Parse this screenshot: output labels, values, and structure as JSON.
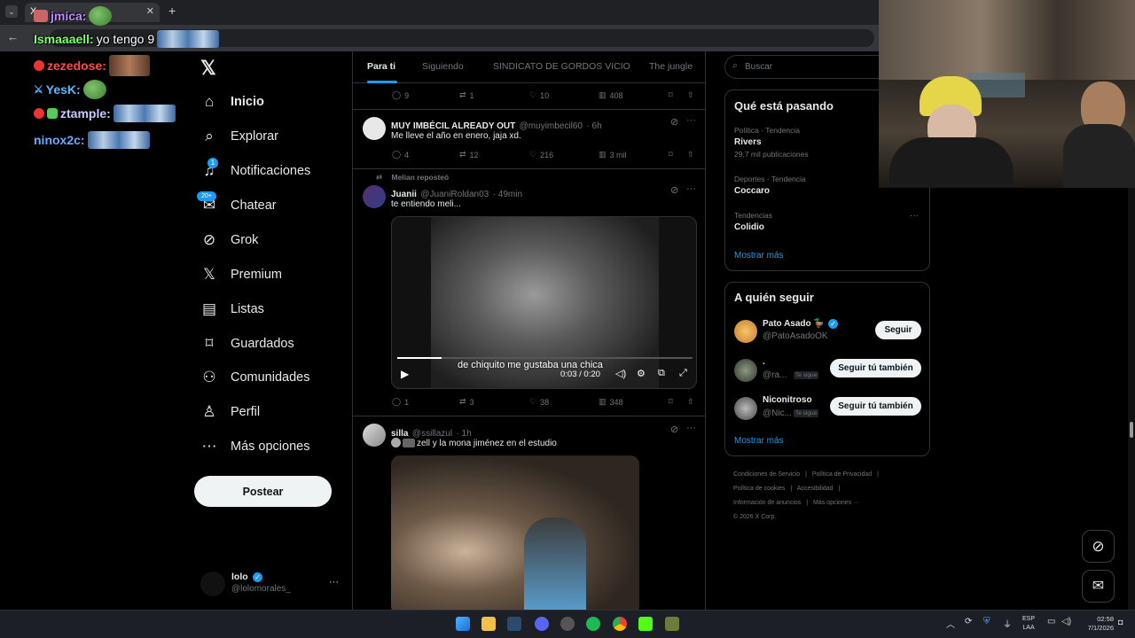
{
  "browser": {
    "tab_title": "X",
    "back_icon": "back-arrow-icon"
  },
  "chat": [
    {
      "user": "jmica:",
      "color": "#b98cff"
    },
    {
      "user": "Ismaaaell:",
      "message": "yo tengo 9",
      "color": "#7dff6b"
    },
    {
      "user": "zezedose:",
      "color": "#ff4a4a"
    },
    {
      "user": "YesK:",
      "color": "#59b8ff"
    },
    {
      "user": "ztample:",
      "color": "#c9c9ff"
    },
    {
      "user": "ninox2c:",
      "color": "#6fa8ff"
    }
  ],
  "nav": {
    "items": [
      {
        "label": "Inicio",
        "icon": "home-icon"
      },
      {
        "label": "Explorar",
        "icon": "search-icon"
      },
      {
        "label": "Notificaciones",
        "icon": "bell-icon",
        "badge": "1"
      },
      {
        "label": "Chatear",
        "icon": "mail-icon",
        "badge": "20+"
      },
      {
        "label": "Grok",
        "icon": "grok-icon"
      },
      {
        "label": "Premium",
        "icon": "x-icon"
      },
      {
        "label": "Listas",
        "icon": "list-icon"
      },
      {
        "label": "Guardados",
        "icon": "bookmark-icon"
      },
      {
        "label": "Comunidades",
        "icon": "communities-icon"
      },
      {
        "label": "Perfil",
        "icon": "person-icon"
      },
      {
        "label": "Más opciones",
        "icon": "more-circle-icon"
      }
    ],
    "post_label": "Postear",
    "account": {
      "name": "lolo",
      "handle": "@lolomorales_",
      "more": "···"
    }
  },
  "feed": {
    "tabs": [
      "Para ti",
      "Siguiendo",
      "SINDICATO DE GORDOS VICIO",
      "The jungle"
    ],
    "top_actions": {
      "replies": "9",
      "reposts": "1",
      "likes": "10",
      "views": "408"
    },
    "tweets": [
      {
        "name": "MUY IMBÉCIL ALREADY OUT",
        "handle": "@muyimbecil60",
        "time": "· 6h",
        "text": "Me lleve el año en enero, jaja xd.",
        "replies": "4",
        "reposts": "12",
        "likes": "216",
        "views": "3 mil"
      },
      {
        "repost_note": "Melian reposteó",
        "name": "Juanii",
        "handle": "@JuaniRoldan03",
        "time": "· 49min",
        "text": "te entiendo meli...",
        "video_caption": "de chiquito me gustaba una chica",
        "video_time": "0:03 / 0:20",
        "replies": "1",
        "reposts": "3",
        "likes": "38",
        "views": "348"
      },
      {
        "name": "silla",
        "handle": "@ssillazul",
        "time": "· 1h",
        "text": "zell y la mona jiménez en el estudio"
      }
    ]
  },
  "right": {
    "search_placeholder": "Buscar",
    "trends_title": "Qué está pasando",
    "trends": [
      {
        "meta": "Política · Tendencia",
        "name": "Rivers",
        "count": "29,7 mil publicaciones"
      },
      {
        "meta": "Deportes · Tendencia",
        "name": "Coccaro"
      },
      {
        "meta": "Tendencias",
        "name": "Colidio"
      }
    ],
    "trends_more": "Mostrar más",
    "follow_title": "A quién seguir",
    "follow": [
      {
        "name": "Pato Asado 🦆",
        "handle": "@PatoAsadoOK",
        "button": "Seguir"
      },
      {
        "name": ".",
        "handle": "@ra...",
        "tag": "Te sigue",
        "button": "Seguir tú también"
      },
      {
        "name": "Niconitroso",
        "handle": "@Nic...",
        "tag": "Te sigue",
        "button": "Seguir tú también"
      }
    ],
    "follow_more": "Mostrar más",
    "footer": [
      "Condiciones de Servicio",
      "|",
      "Política de Privacidad",
      "|",
      "Política de cookies",
      "|",
      "Accesibilidad",
      "|",
      "Información de anuncios",
      "|",
      "Más opciones ···",
      "© 2026 X Corp."
    ]
  },
  "taskbar": {
    "lang": "ESP",
    "lang2": "LAA",
    "time": "02:58",
    "date": "7/1/2026"
  },
  "colors": {
    "accent": "#1d9bf0",
    "bg": "#000000",
    "border": "#2f3336",
    "muted": "#71767b"
  }
}
